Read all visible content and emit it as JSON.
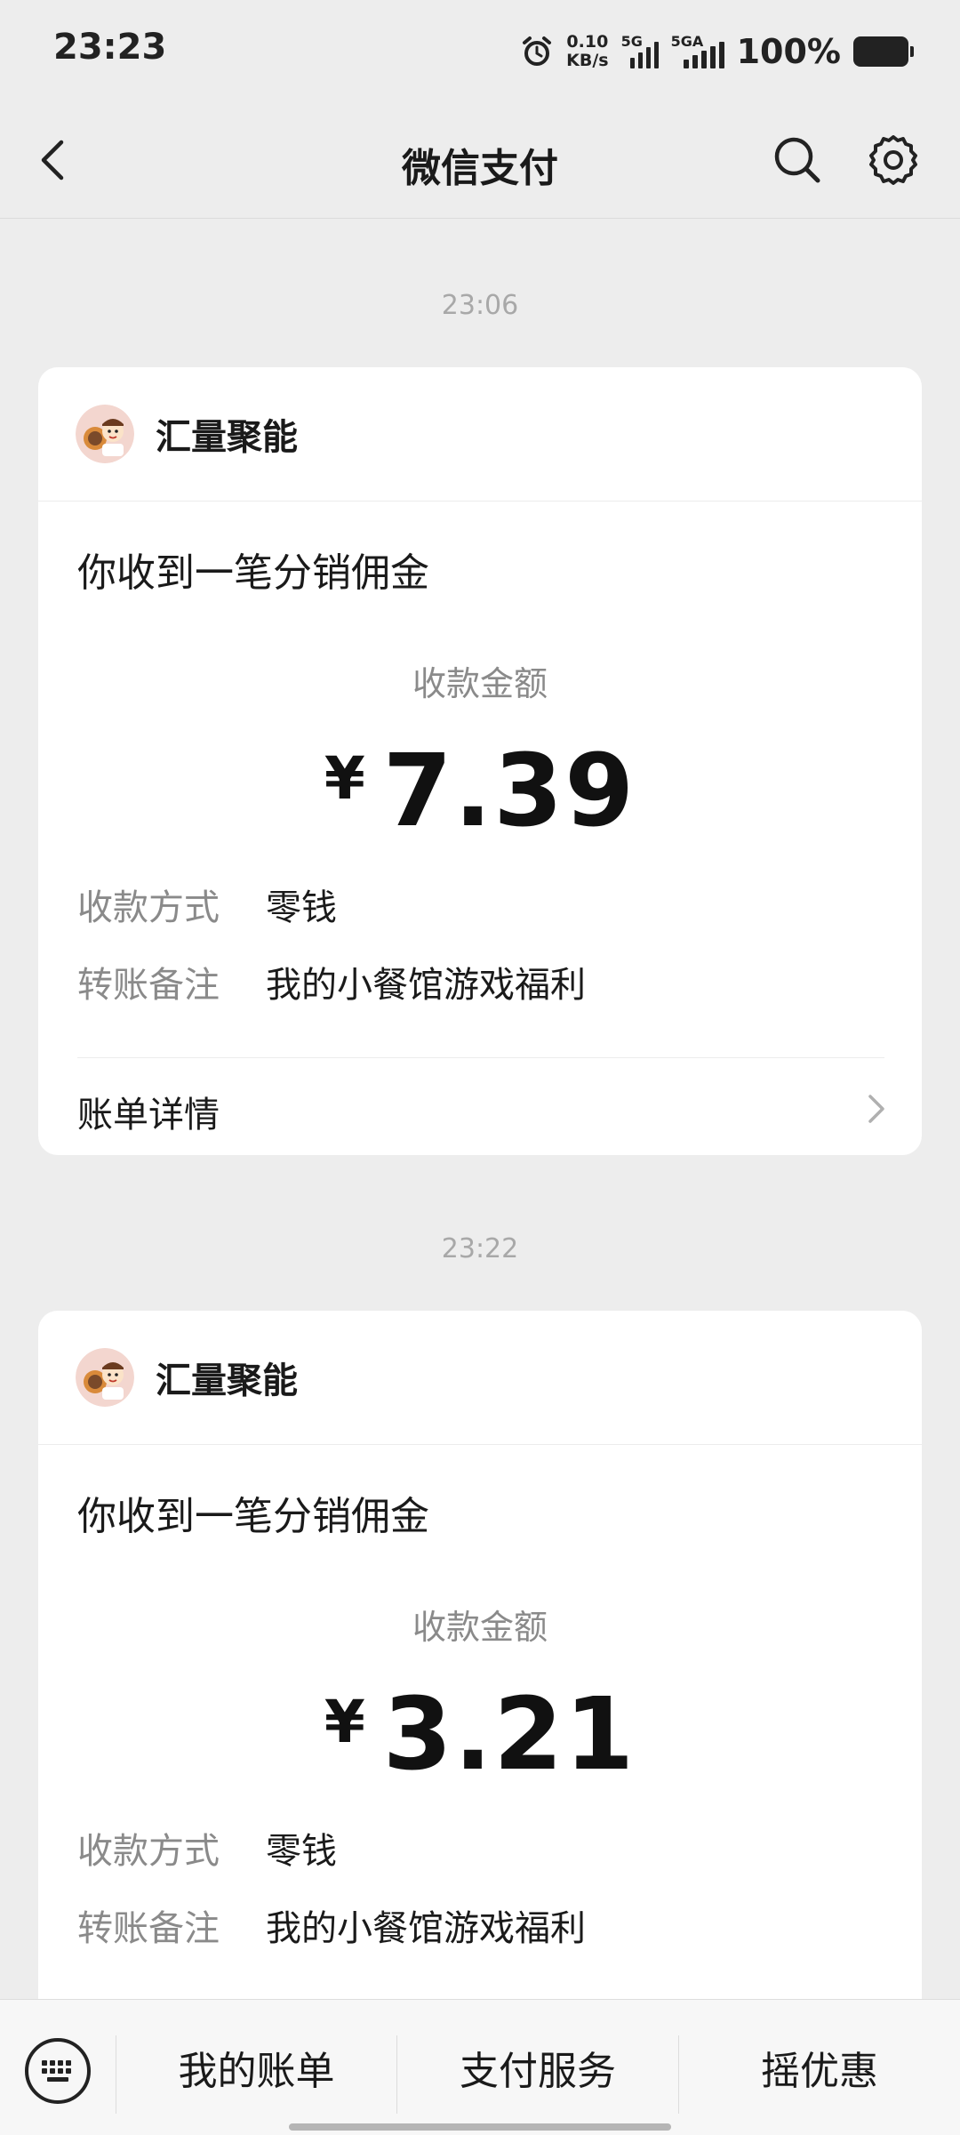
{
  "status_bar": {
    "time": "23:23",
    "net_speed_value": "0.10",
    "net_speed_unit": "KB/s",
    "signal1_label": "5G",
    "signal2_label": "5GA",
    "battery": "100%"
  },
  "nav": {
    "title": "微信支付",
    "back_icon": "chevron-left-icon",
    "search_icon": "search-icon",
    "settings_icon": "gear-icon"
  },
  "messages": [
    {
      "time": "23:06",
      "merchant": "汇量聚能",
      "title": "你收到一笔分销佣金",
      "amount_label": "收款金额",
      "currency": "¥",
      "amount": "7.39",
      "method_key": "收款方式",
      "method_value": "零钱",
      "note_key": "转账备注",
      "note_value": "我的小餐馆游戏福利",
      "detail_label": "账单详情"
    },
    {
      "time": "23:22",
      "merchant": "汇量聚能",
      "title": "你收到一笔分销佣金",
      "amount_label": "收款金额",
      "currency": "¥",
      "amount": "3.21",
      "method_key": "收款方式",
      "method_value": "零钱",
      "note_key": "转账备注",
      "note_value": "我的小餐馆游戏福利"
    }
  ],
  "bottom_bar": {
    "keyboard_icon": "keyboard-icon",
    "items": [
      "我的账单",
      "支付服务",
      "摇优惠"
    ]
  },
  "colors": {
    "background": "#ededed",
    "card": "#ffffff",
    "secondary_text": "#8a8a8a"
  }
}
